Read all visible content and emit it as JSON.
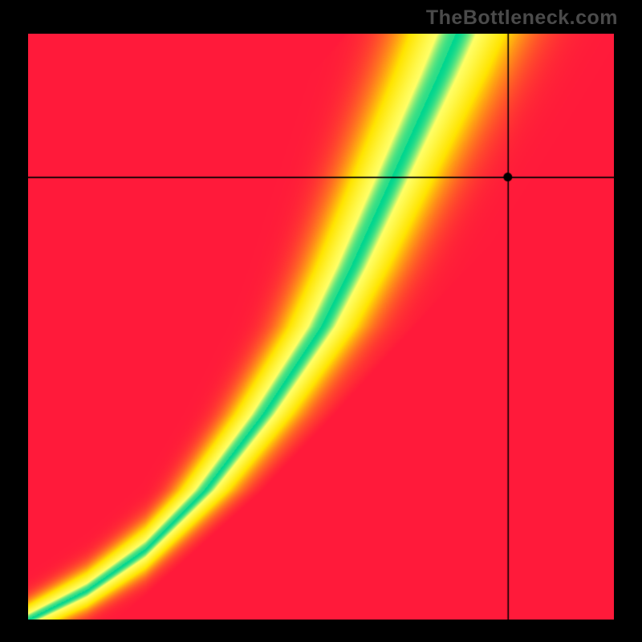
{
  "watermark": "TheBottleneck.com",
  "colors": {
    "background": "#000000",
    "watermark": "#4a4a4a",
    "crosshair": "#000000",
    "marker_fill": "#000000"
  },
  "chart_data": {
    "type": "heatmap",
    "title": "",
    "xlabel": "",
    "ylabel": "",
    "xlim": [
      0,
      1
    ],
    "ylim": [
      0,
      1
    ],
    "notes": "Value at (x,y) is fit score in [0,1]; 0=red, 0.5=yellow, 1=green. x increases right, y increases up. Overlaid crosshair marks a point of interest.",
    "crosshair": {
      "x": 0.82,
      "y": 0.755
    },
    "ideal_curve_samples": [
      {
        "x": 0.0,
        "y": 0.0
      },
      {
        "x": 0.1,
        "y": 0.05
      },
      {
        "x": 0.2,
        "y": 0.12
      },
      {
        "x": 0.3,
        "y": 0.22
      },
      {
        "x": 0.4,
        "y": 0.35
      },
      {
        "x": 0.5,
        "y": 0.5
      },
      {
        "x": 0.55,
        "y": 0.6
      },
      {
        "x": 0.6,
        "y": 0.71
      },
      {
        "x": 0.65,
        "y": 0.82
      },
      {
        "x": 0.7,
        "y": 0.93
      },
      {
        "x": 0.73,
        "y": 1.0
      }
    ],
    "color_stops": [
      {
        "value": 0.0,
        "color": "#ff1a3a"
      },
      {
        "value": 0.5,
        "color": "#ffe400"
      },
      {
        "value": 0.88,
        "color": "#ffff66"
      },
      {
        "value": 1.0,
        "color": "#00d68f"
      }
    ]
  }
}
